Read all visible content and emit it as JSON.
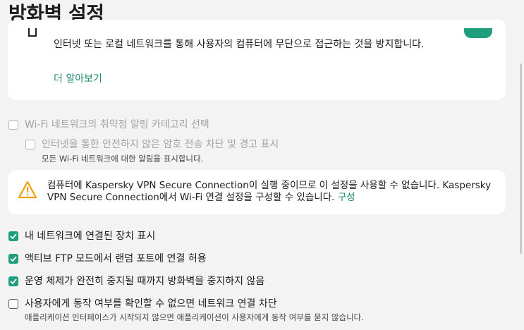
{
  "page": {
    "title": "방화벽 설정"
  },
  "top_card": {
    "description": "인터넷 또는 로컬 네트워크를 통해 사용자의 컴퓨터에 무단으로 접근하는 것을 방지합니다.",
    "learn_more": "더 알아보기",
    "toggle_on": true
  },
  "wifi": {
    "category_label": "Wi-Fi 네트워크의 취약점 알림 카테고리 선택",
    "insecure_label": "인터넷을 통한 안전하지 않은 암호 전송 차단 및 경고 표시",
    "insecure_sub": "모든 Wi-Fi 네트워크에 대한 알림을 표시합니다."
  },
  "warning": {
    "text": "컴퓨터에 Kaspersky VPN Secure Connection이 실행 중이므로 이 설정을 사용할 수 없습니다. Kaspersky VPN Secure Connection에서 Wi-Fi 연결 설정을 구성할 수 있습니다.",
    "link": "구성"
  },
  "options": [
    {
      "label": "내 네트워크에 연결된 장치 표시",
      "checked": true
    },
    {
      "label": "액티브 FTP 모드에서 랜덤 포트에 연결 허용",
      "checked": true
    },
    {
      "label": "운영 체제가 완전히 중지될 때까지 방화벽을 중지하지 않음",
      "checked": true
    },
    {
      "label": "사용자에게 동작 여부를 확인할 수 없으면 네트워크 연결 차단",
      "checked": false,
      "sub": "애플리케이션 인터페이스가 시작되지 않으면 애플리케이션이 사용자에게 동작 여부를 묻지 않습니다."
    }
  ],
  "colors": {
    "accent": "#1f9e7d",
    "warning": "#f0a000"
  }
}
